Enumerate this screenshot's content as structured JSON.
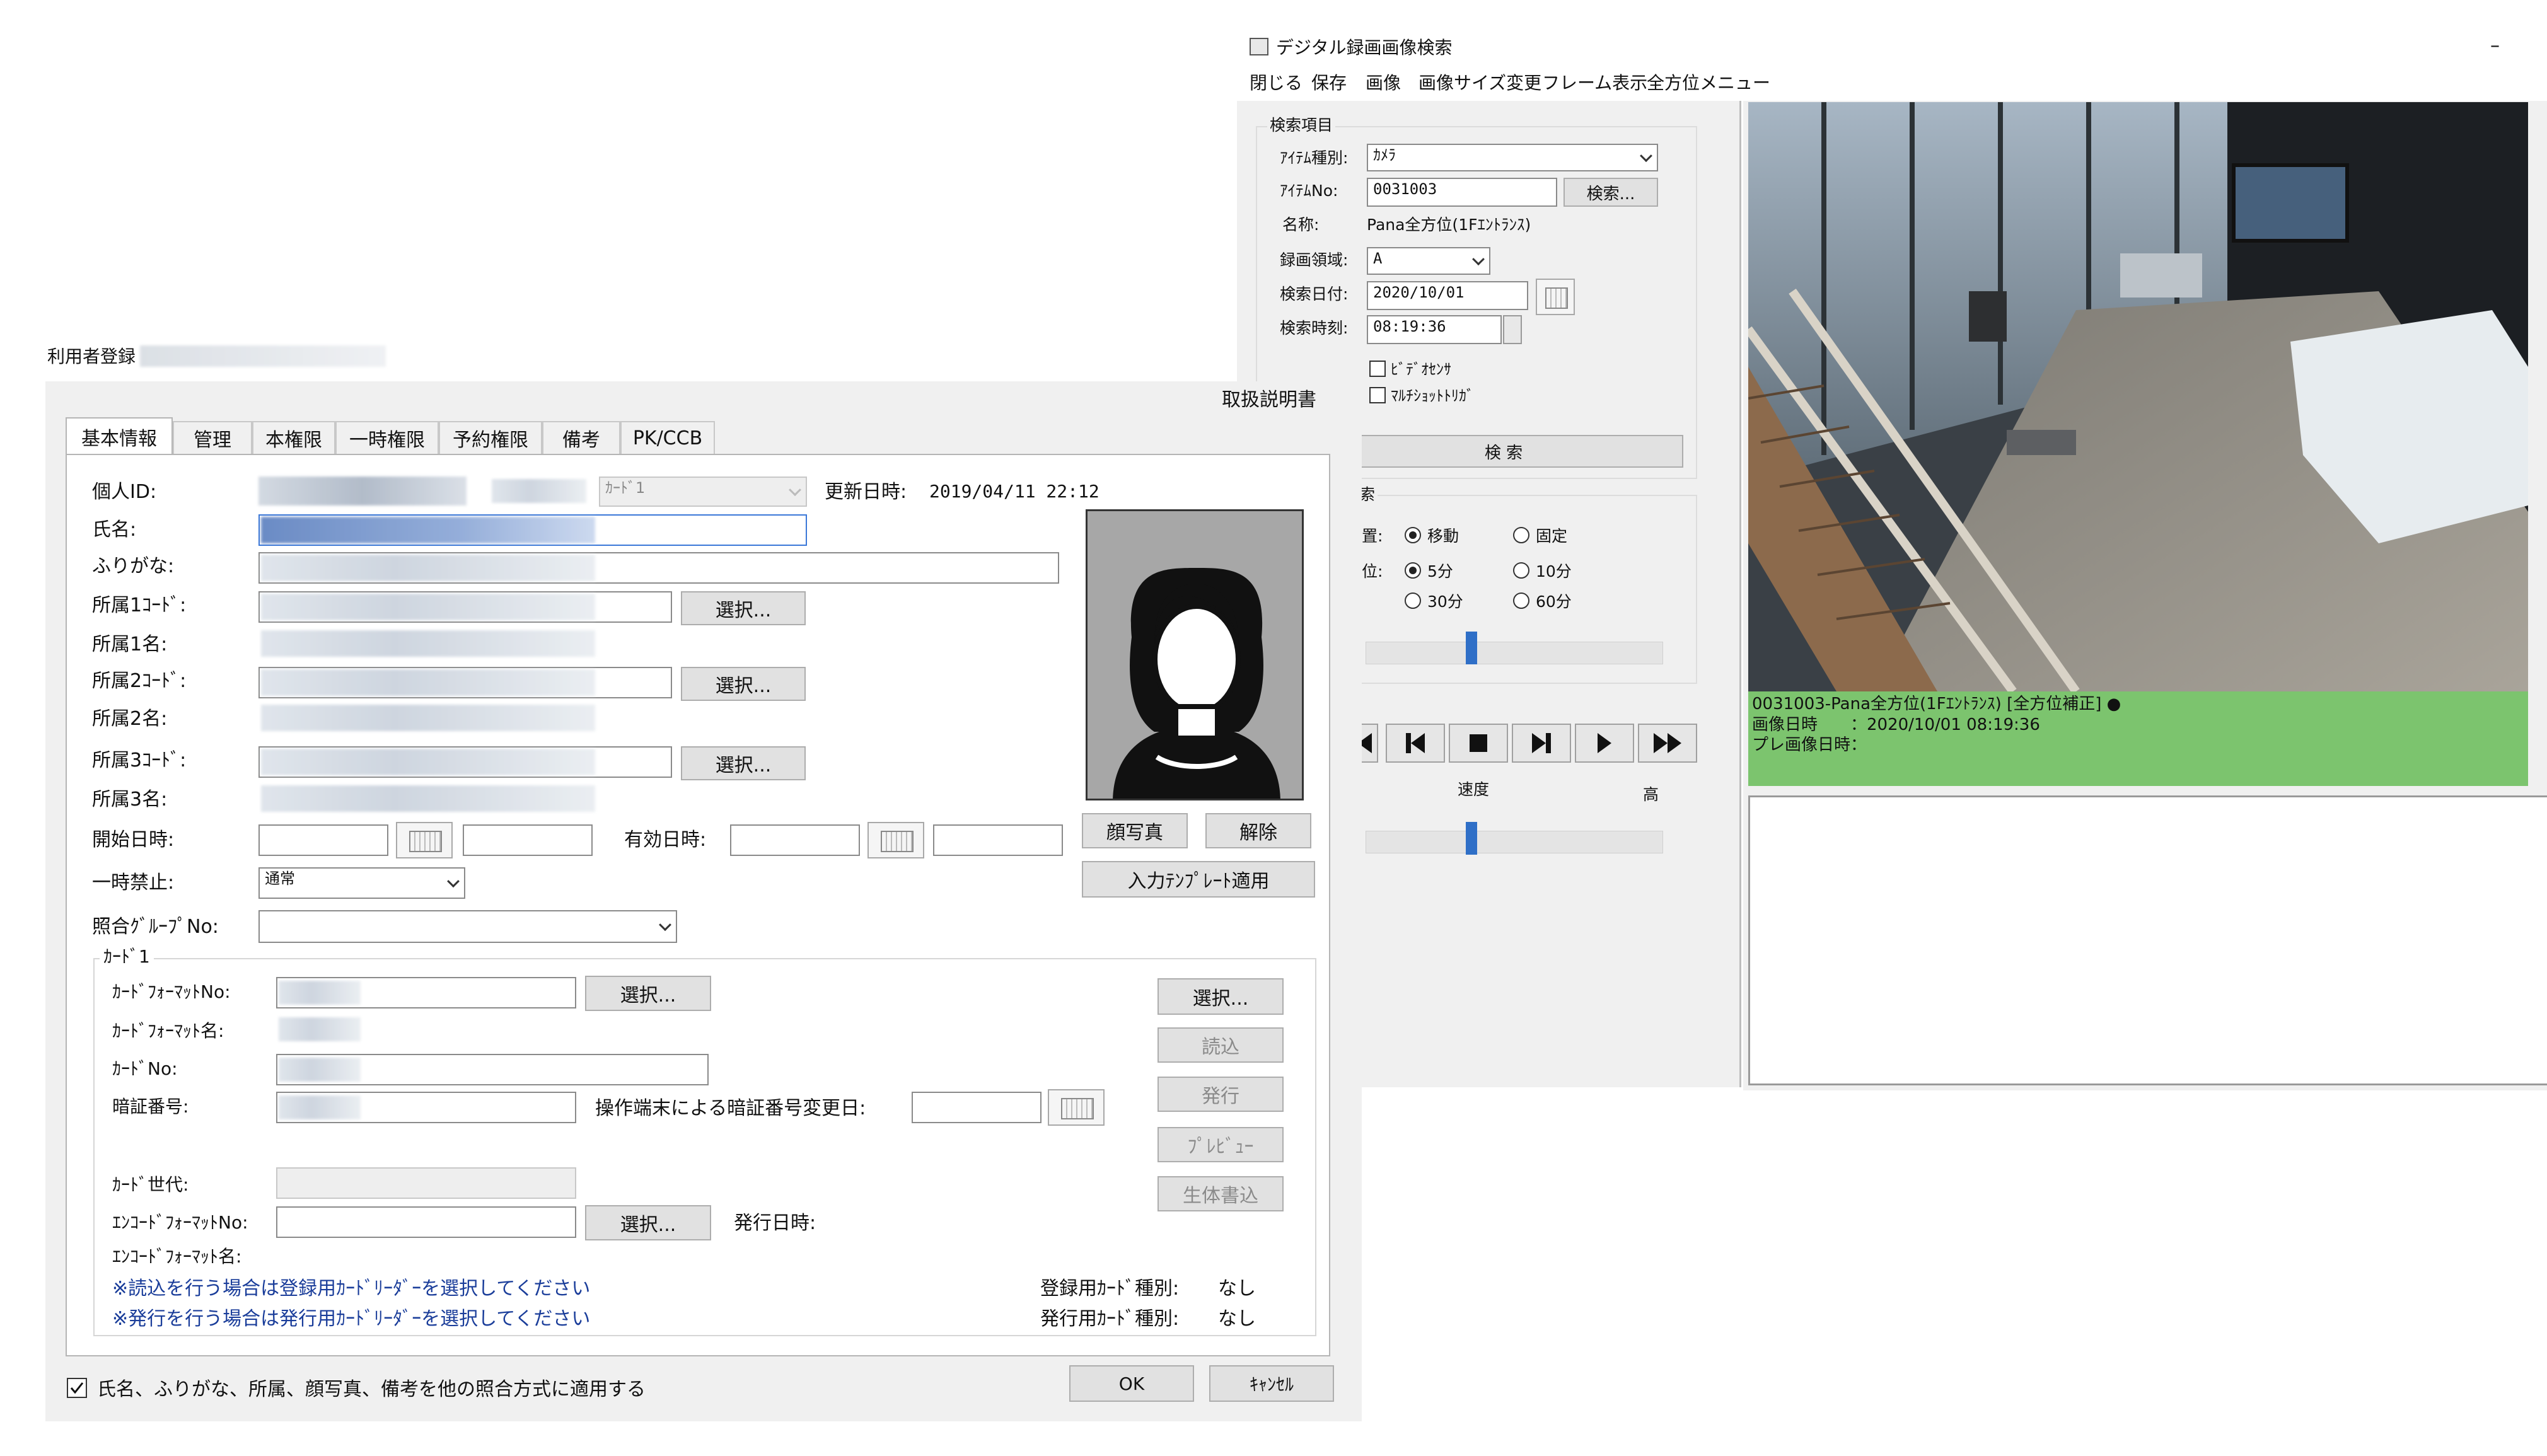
{
  "right_window": {
    "title": "デジタル録画画像検索",
    "minimize": "–",
    "menu": [
      "閉じる",
      "保存",
      "画像",
      "画像サイズ変更",
      "フレーム表示",
      "全方位メニュー"
    ],
    "search": {
      "group_label": "検索項目",
      "item_type_label": "ｱｲﾃﾑ種別:",
      "item_type_value": "ｶﾒﾗ",
      "item_no_label": "ｱｲﾃﾑNo:",
      "item_no_value": "0031003",
      "search_btn": "検索...",
      "name_label": "名称:",
      "name_value": "Pana全方位(1Fｴﾝﾄﾗﾝｽ)",
      "area_label": "録画領域:",
      "area_value": "A",
      "date_label": "検索日付:",
      "date_value": "2020/10/01",
      "time_label": "検索時刻:",
      "time_value": "08:19:36",
      "cb_video_sensor": "ﾋﾞﾃﾞｵｾﾝｻ",
      "cb_multishot": "ﾏﾙﾁｼｮｯﾄﾄﾘｶﾞ",
      "exec_btn": "検 索"
    },
    "position": {
      "group_partial": "索",
      "mode_label": "置:",
      "mode_move": "移動",
      "mode_fixed": "固定",
      "unit_label": "位:",
      "unit_5": "5分",
      "unit_10": "10分",
      "unit_30": "30分",
      "unit_60": "60分"
    },
    "speed_label": "速度",
    "speed_high": "高",
    "camera_info": {
      "line1": "0031003-Pana全方位(1Fｴﾝﾄﾗﾝｽ) [全方位補正] ●",
      "line2": "画像日時　　：2020/10/01 08:19:36",
      "line3": "プレ画像日時："
    }
  },
  "left_window": {
    "title": "利用者登録",
    "manual": "取扱説明書",
    "tabs": [
      "基本情報",
      "管理",
      "本権限",
      "一時権限",
      "予約権限",
      "備考",
      "PK/CCB"
    ],
    "personal_id": "個人ID:",
    "card_type_value": "ｶｰﾄﾞ1",
    "updated_label": "更新日時:",
    "updated_value": "2019/04/11 22:12",
    "name": "氏名:",
    "furigana": "ふりがな:",
    "dept1_code": "所属1ｺｰﾄﾞ:",
    "dept1_name": "所属1名:",
    "dept2_code": "所属2ｺｰﾄﾞ:",
    "dept2_name": "所属2名:",
    "dept3_code": "所属3ｺｰﾄﾞ:",
    "dept3_name": "所属3名:",
    "select_btn": "選択...",
    "start_label": "開始日時:",
    "valid_label": "有効日時:",
    "suspend_label": "一時禁止:",
    "suspend_value": "通常",
    "group_no_label": "照合ｸﾞﾙｰﾌﾟNo:",
    "photo_btn": "顔写真",
    "release_btn": "解除",
    "template_btn": "入力ﾃﾝﾌﾟﾚｰﾄ適用",
    "card_group": "ｶｰﾄﾞ1",
    "card_format_no": "ｶｰﾄﾞﾌｫｰﾏｯﾄNo:",
    "card_format_name": "ｶｰﾄﾞﾌｫｰﾏｯﾄ名:",
    "card_no": "ｶｰﾄﾞNo:",
    "pin": "暗証番号:",
    "pin_change": "操作端末による暗証番号変更日:",
    "card_gen": "ｶｰﾄﾞ世代:",
    "encode_format_no": "ｴﾝｺｰﾄﾞﾌｫｰﾏｯﾄNo:",
    "issue_date": "発行日時:",
    "encode_format_name": "ｴﾝｺｰﾄﾞﾌｫｰﾏｯﾄ名:",
    "note1": "※読込を行う場合は登録用ｶｰﾄﾞﾘｰﾀﾞｰを選択してください",
    "note2": "※発行を行う場合は発行用ｶｰﾄﾞﾘｰﾀﾞｰを選択してください",
    "reg_type_label": "登録用ｶｰﾄﾞ種別:",
    "reg_type_value": "なし",
    "issue_type_label": "発行用ｶｰﾄﾞ種別:",
    "issue_type_value": "なし",
    "read_btn": "読込",
    "issue_btn": "発行",
    "preview_btn": "ﾌﾟﾚﾋﾞｭｰ",
    "bio_btn": "生体書込",
    "apply_check": "氏名、ふりがな、所属、顔写真、備考を他の照合方式に適用する",
    "ok_btn": "OK",
    "cancel_btn": "ｷｬﾝｾﾙ"
  }
}
